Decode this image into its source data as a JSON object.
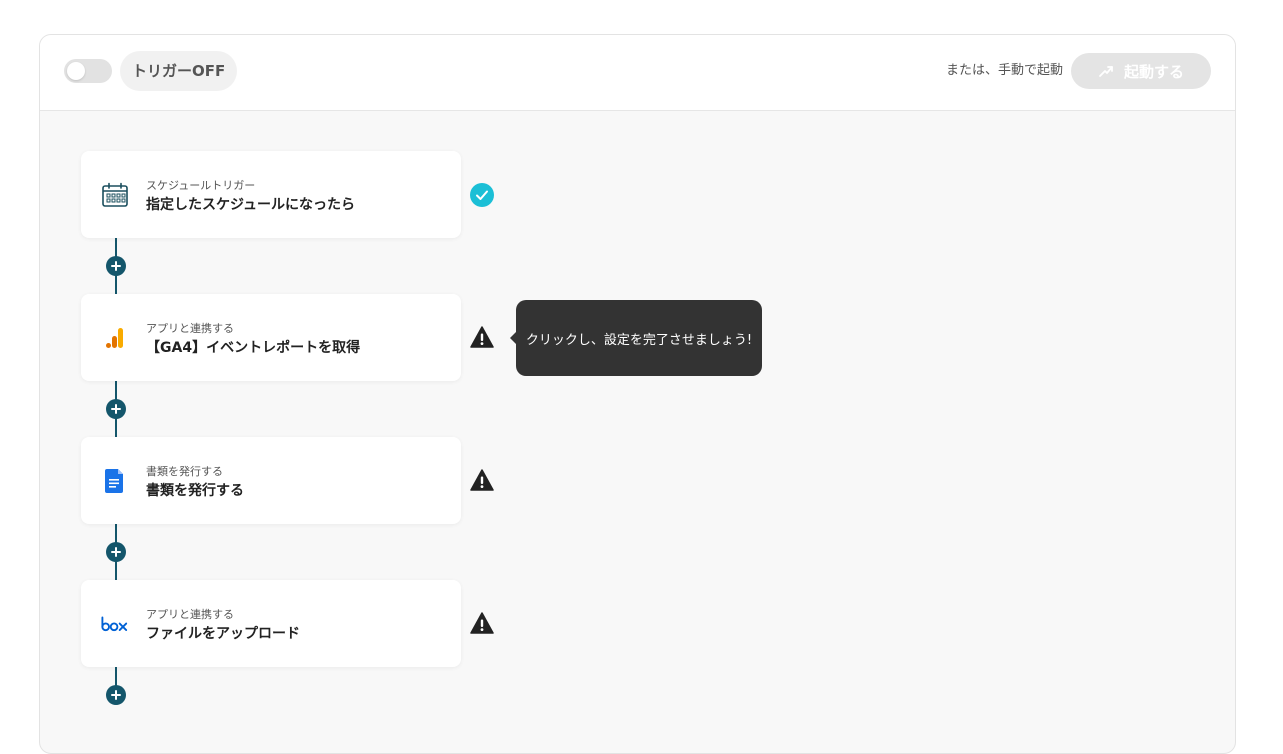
{
  "header": {
    "toggle_state": "off",
    "trigger_label": "トリガーOFF",
    "manual_text": "または、手動で起動",
    "start_label": "起動する"
  },
  "steps": [
    {
      "subtitle": "スケジュールトリガー",
      "title": "指定したスケジュールになったら",
      "icon": "calendar-schedule-icon",
      "status": "complete"
    },
    {
      "subtitle": "アプリと連携する",
      "title": "【GA4】イベントレポートを取得",
      "icon": "google-analytics-icon",
      "status": "warning"
    },
    {
      "subtitle": "書類を発行する",
      "title": "書類を発行する",
      "icon": "google-docs-icon",
      "status": "warning"
    },
    {
      "subtitle": "アプリと連携する",
      "title": "ファイルをアップロード",
      "icon": "box-icon",
      "status": "warning"
    }
  ],
  "tooltip": {
    "text": "クリックし、設定を完了させましょう!"
  },
  "colors": {
    "connector": "#14566b",
    "check": "#1bbfd6",
    "warning": "#222222",
    "tooltip_bg": "#333333",
    "ga_orange": "#f9ab00",
    "ga_dark_orange": "#e37400",
    "docs_blue": "#1a73e8",
    "box_blue": "#0061d5"
  }
}
